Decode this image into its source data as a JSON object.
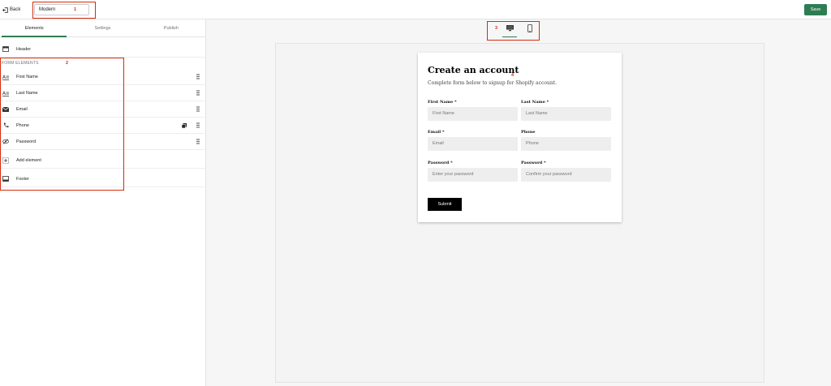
{
  "topbar": {
    "back_label": "Back",
    "template_name": "Modern",
    "save_label": "Save"
  },
  "callouts": [
    "1",
    "2",
    "3",
    "4"
  ],
  "sidebar": {
    "tabs": [
      {
        "label": "Elements",
        "active": true
      },
      {
        "label": "Settings",
        "active": false
      },
      {
        "label": "Publish",
        "active": false
      }
    ],
    "header_item": "Header",
    "section_label": "FORM ELEMENTS",
    "elements": [
      {
        "label": "First Name",
        "icon": "text-field-icon"
      },
      {
        "label": "Last Name",
        "icon": "text-field-icon"
      },
      {
        "label": "Email",
        "icon": "envelope-icon"
      },
      {
        "label": "Phone",
        "icon": "phone-icon"
      },
      {
        "label": "Password",
        "icon": "eye-slash-icon"
      }
    ],
    "add_element": "Add element",
    "footer_item": "Footer"
  },
  "form": {
    "title": "Create an account",
    "subtitle": "Complete form below to signup for Shopify account.",
    "first_name_label": "First Name *",
    "first_name_placeholder": "First Name",
    "last_name_label": "Last Name *",
    "last_name_placeholder": "Last Name",
    "email_label": "Email *",
    "email_placeholder": "Email",
    "phone_label": "Phone",
    "phone_placeholder": "Phone",
    "password_label": "Password *",
    "password_placeholder": "Enter your password",
    "confirm_label": "Password *",
    "confirm_placeholder": "Confirm your password",
    "submit_label": "Submit"
  },
  "colors": {
    "accent": "#2e7d52",
    "callout": "#d82c0d"
  }
}
